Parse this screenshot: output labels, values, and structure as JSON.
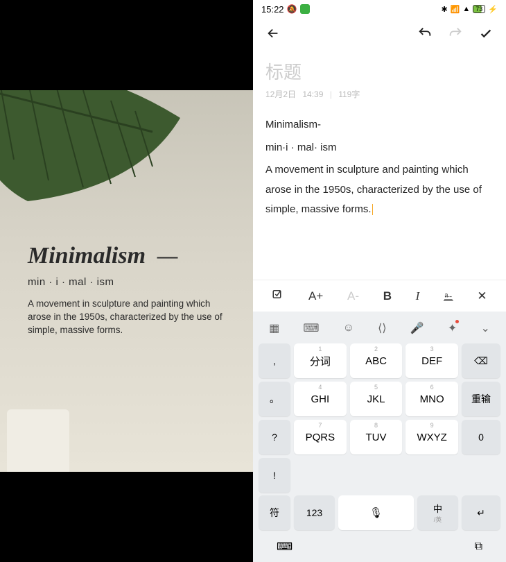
{
  "photo": {
    "title": "Minimalism",
    "pronunciation": "min · i · mal · ism",
    "definition": "A movement in sculpture and painting which arose in the 1950s, characterized by the use of simple, massive forms."
  },
  "status": {
    "time": "15:22",
    "battery": "73"
  },
  "note": {
    "title_placeholder": "标题",
    "date": "12月2日",
    "time": "14:39",
    "char_count": "119字",
    "line1": "Minimalism-",
    "line2": "min·i · mal· ism",
    "line3": "A movement in sculpture and painting which arose in the 1950s, characterized by the use of simple, massive forms."
  },
  "fmt": {
    "list": "☑",
    "inc": "A+",
    "dec": "A-",
    "bold": "B",
    "italic": "I",
    "strike": "S",
    "close": "✕"
  },
  "kb": {
    "side": [
      ",",
      "。",
      "?",
      "!"
    ],
    "keys": [
      {
        "n": "1",
        "t": "分词"
      },
      {
        "n": "2",
        "t": "ABC"
      },
      {
        "n": "3",
        "t": "DEF"
      },
      {
        "n": "4",
        "t": "GHI"
      },
      {
        "n": "5",
        "t": "JKL"
      },
      {
        "n": "6",
        "t": "MNO"
      },
      {
        "n": "7",
        "t": "PQRS"
      },
      {
        "n": "8",
        "t": "TUV"
      },
      {
        "n": "9",
        "t": "WXYZ"
      }
    ],
    "backspace": "⌫",
    "retype": "重输",
    "zero": "0",
    "sym": "符",
    "num": "123",
    "lang": "中",
    "lang_sub": "/英",
    "enter": "↵"
  }
}
